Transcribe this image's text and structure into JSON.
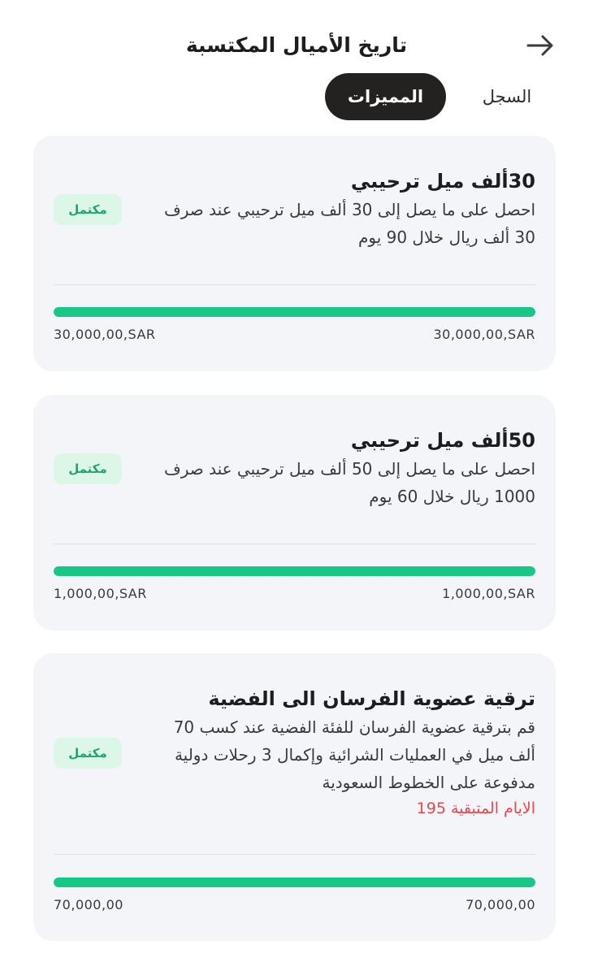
{
  "header": {
    "title": "تاريخ الأميال المكتسبة",
    "back_icon": "arrow-right-icon"
  },
  "tabs": [
    {
      "label": "السجل",
      "active": false
    },
    {
      "label": "المميزات",
      "active": true
    }
  ],
  "colors": {
    "accent_green": "#17c786",
    "badge_bg": "#dcf6e7",
    "badge_text": "#19a86a",
    "remaining_red": "#e5484d",
    "active_tab_bg": "#242121",
    "card_bg": "#f4f5f9"
  },
  "cards": [
    {
      "title": "30ألف ميل ترحيبي",
      "description": "احصل على ما يصل إلى 30 ألف ميل ترحيبي عند صرف 30 ألف ريال خلال 90 يوم",
      "status": "مكتمل",
      "progress": 1.0,
      "amount_left": "30,000,00,SAR",
      "amount_right": "30,000,00,SAR"
    },
    {
      "title": "50ألف ميل ترحيبي",
      "description": "احصل على ما يصل إلى 50 ألف ميل ترحيبي عند صرف 1000 ريال خلال 60 يوم",
      "status": "مكتمل",
      "progress": 1.0,
      "amount_left": "1,000,00,SAR",
      "amount_right": "1,000,00,SAR"
    },
    {
      "title": "ترقية عضوية الفرسان الى الفضية",
      "description": "قم بترقية عضوية الفرسان للفئة الفضية عند كسب 70 ألف ميل في العمليات الشرائية وإكمال 3 رحلات دولية مدفوعة على الخطوط السعودية",
      "remaining": "الايام المتبقية 195",
      "status": "مكتمل",
      "progress": 1.0,
      "amount_left": "70,000,00",
      "amount_right": "70,000,00"
    }
  ]
}
